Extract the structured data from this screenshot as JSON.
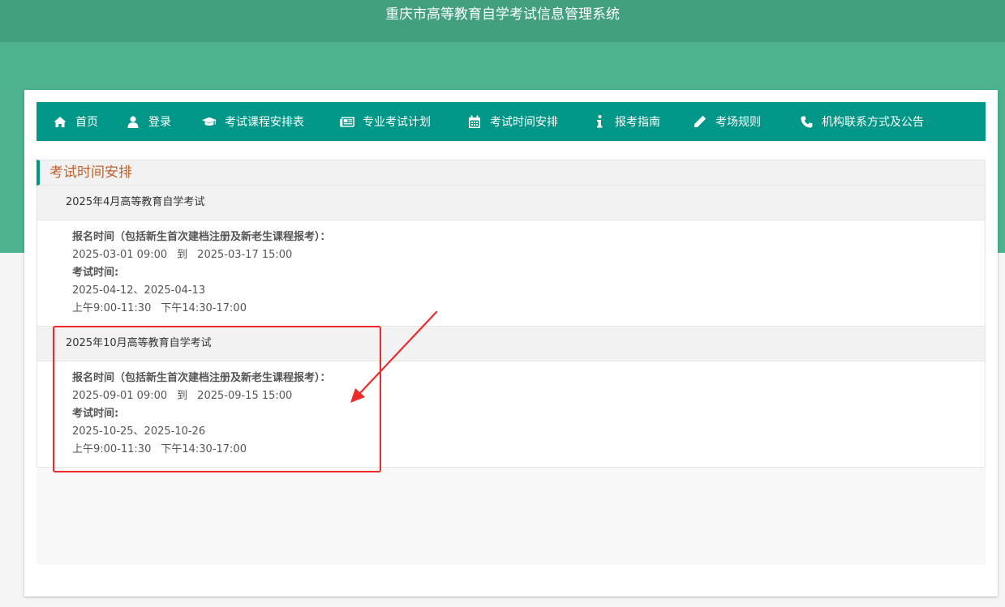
{
  "header": {
    "title": "重庆市高等教育自学考试信息管理系统"
  },
  "nav": {
    "items": [
      {
        "label": "首页",
        "icon": "home-icon"
      },
      {
        "label": "登录",
        "icon": "user-icon"
      },
      {
        "label": "考试课程安排表",
        "icon": "graduation-cap-icon"
      },
      {
        "label": "专业考试计划",
        "icon": "newspaper-icon"
      },
      {
        "label": "考试时间安排",
        "icon": "calendar-icon"
      },
      {
        "label": "报考指南",
        "icon": "info-icon"
      },
      {
        "label": "考场规则",
        "icon": "pencil-icon"
      },
      {
        "label": "机构联系方式及公告",
        "icon": "phone-icon"
      }
    ]
  },
  "panel": {
    "title": "考试时间安排",
    "sections": [
      {
        "title": "2025年4月高等教育自学考试",
        "registration_label": "报名时间（包括新生首次建档注册及新老生课程报考）：",
        "registration_start": "2025-03-01 09:00",
        "registration_to": "到",
        "registration_end": "2025-03-17 15:00",
        "exam_label": "考试时间:",
        "exam_dates": "2025-04-12、2025-04-13",
        "morning": "上午9:00-11:30",
        "afternoon": "下午14:30-17:00"
      },
      {
        "title": "2025年10月高等教育自学考试",
        "registration_label": "报名时间（包括新生首次建档注册及新老生课程报考）：",
        "registration_start": "2025-09-01 09:00",
        "registration_to": "到",
        "registration_end": "2025-09-15 15:00",
        "exam_label": "考试时间:",
        "exam_dates": "2025-10-25、2025-10-26",
        "morning": "上午9:00-11:30",
        "afternoon": "下午14:30-17:00"
      }
    ]
  },
  "annotation": {
    "color": "#ee2a2a"
  },
  "colors": {
    "nav_bg": "#009688",
    "header_bg": "#42a07f",
    "band_bg": "#4cb38c",
    "panel_title": "#c0612d"
  }
}
